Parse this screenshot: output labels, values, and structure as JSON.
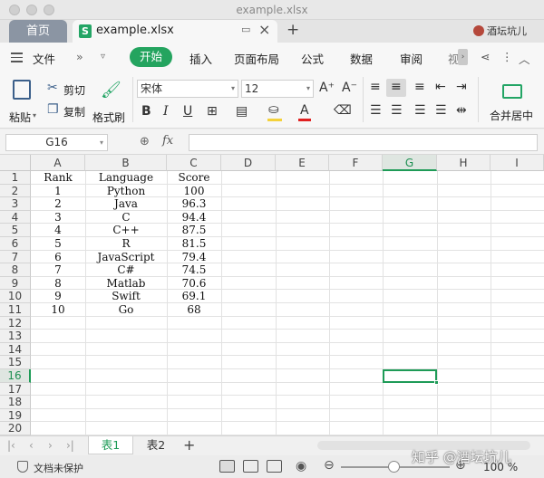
{
  "window": {
    "title": "example.xlsx"
  },
  "tabs": {
    "home": "首页",
    "file": "example.xlsx",
    "add": "+",
    "user": "酒坛坑儿"
  },
  "menu": {
    "file": "文件",
    "start": "开始",
    "insert": "插入",
    "page_layout": "页面布局",
    "formula": "公式",
    "data": "数据",
    "review": "审阅",
    "view_partial": "视"
  },
  "ribbon": {
    "paste": "粘贴",
    "cut": "剪切",
    "copy": "复制",
    "format_painter": "格式刷",
    "font_name": "宋体",
    "font_size": "12",
    "merge_center": "合并居中"
  },
  "formula_bar": {
    "cell_ref": "G16",
    "fx": "fx",
    "value": ""
  },
  "grid": {
    "columns": [
      "A",
      "B",
      "C",
      "D",
      "E",
      "F",
      "G",
      "H",
      "I"
    ],
    "selected_column": "G",
    "rows": [
      "1",
      "2",
      "3",
      "4",
      "5",
      "6",
      "7",
      "8",
      "9",
      "10",
      "11",
      "12",
      "13",
      "14",
      "15",
      "16",
      "17",
      "18",
      "19",
      "20"
    ],
    "selected_row": "16",
    "headers": [
      "Rank",
      "Language",
      "Score"
    ],
    "data": [
      [
        "1",
        "Python",
        "100"
      ],
      [
        "2",
        "Java",
        "96.3"
      ],
      [
        "3",
        "C",
        "94.4"
      ],
      [
        "4",
        "C++",
        "87.5"
      ],
      [
        "5",
        "R",
        "81.5"
      ],
      [
        "6",
        "JavaScript",
        "79.4"
      ],
      [
        "7",
        "C#",
        "74.5"
      ],
      [
        "8",
        "Matlab",
        "70.6"
      ],
      [
        "9",
        "Swift",
        "69.1"
      ],
      [
        "10",
        "Go",
        "68"
      ]
    ]
  },
  "sheets": {
    "sheet1": "表1",
    "sheet2": "表2",
    "add": "+"
  },
  "status": {
    "protection": "文档未保护",
    "zoom": "100 %"
  },
  "watermark": "知乎 @酒坛坑儿",
  "colors": {
    "accent": "#1e9b57",
    "start_pill": "#24a45f",
    "home_tab": "#8b95a3"
  }
}
